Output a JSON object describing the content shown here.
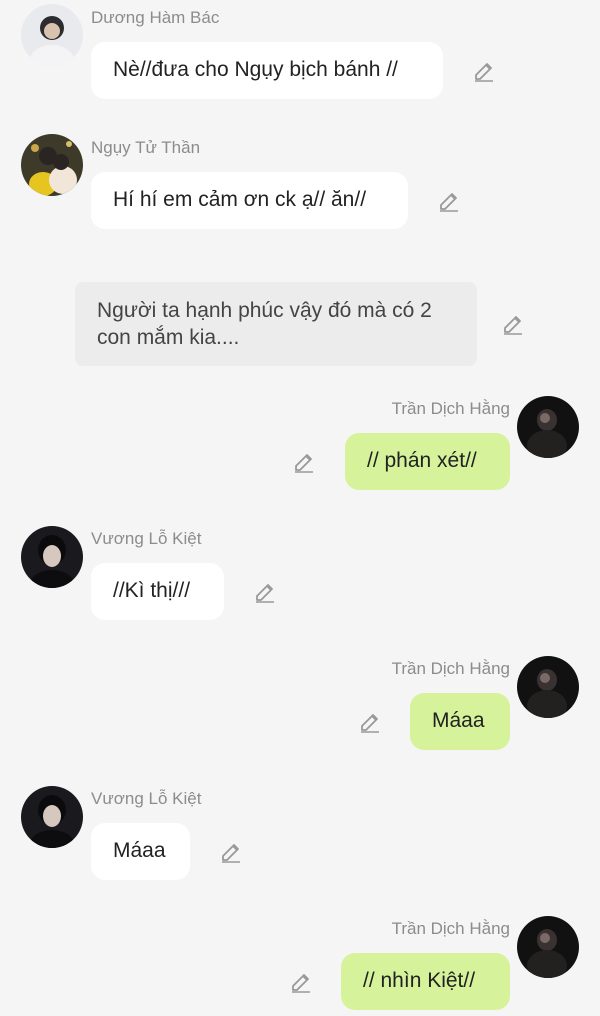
{
  "colors": {
    "background": "#f5f5f5",
    "incoming_bubble": "#ffffff",
    "outgoing_bubble": "#d6f39b",
    "narration_bubble": "#ececec",
    "sender_name": "#8c8c8c",
    "edit_icon": "#999999"
  },
  "messages": [
    {
      "type": "incoming",
      "sender": "Dương Hàm Bác",
      "text": "Nè//đưa cho Ngụy bịch bánh //",
      "icon": "pencil-icon"
    },
    {
      "type": "incoming",
      "sender": "Ngụy Tử Thần",
      "text": "Hí hí em cảm ơn ck ạ// ăn//",
      "icon": "pencil-icon"
    },
    {
      "type": "narration",
      "text": "Người ta hạnh phúc vậy đó mà có 2 con mắm kia....",
      "icon": "pencil-icon"
    },
    {
      "type": "outgoing",
      "sender": "Trần Dịch Hằng",
      "text": "// phán xét//",
      "icon": "pencil-icon"
    },
    {
      "type": "incoming",
      "sender": "Vương Lỗ Kiệt",
      "text": "//Kì thị///",
      "icon": "pencil-icon"
    },
    {
      "type": "outgoing",
      "sender": "Trần Dịch Hằng",
      "text": "Máaa",
      "icon": "pencil-icon"
    },
    {
      "type": "incoming",
      "sender": "Vương Lỗ Kiệt",
      "text": "Máaa",
      "icon": "pencil-icon"
    },
    {
      "type": "outgoing",
      "sender": "Trần Dịch Hằng",
      "text": "// nhìn Kiệt//",
      "icon": "pencil-icon"
    }
  ]
}
